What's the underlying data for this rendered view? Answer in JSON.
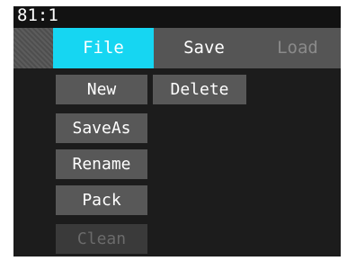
{
  "status": {
    "position": "81:1"
  },
  "tabs": {
    "file": "File",
    "save": "Save",
    "load": "Load"
  },
  "menu": {
    "new": "New",
    "delete": "Delete",
    "save_as": "SaveAs",
    "rename": "Rename",
    "pack": "Pack",
    "clean": "Clean"
  },
  "colors": {
    "accent": "#16d6f2",
    "screen_bg": "#1c1c1c",
    "button_bg": "#585858",
    "disabled_text": "#6b6b6b"
  }
}
